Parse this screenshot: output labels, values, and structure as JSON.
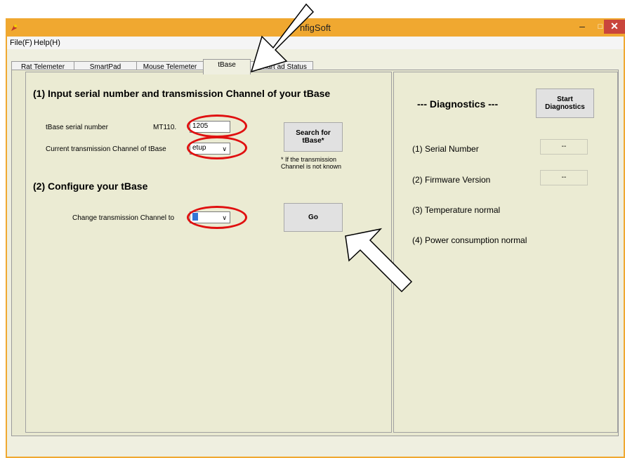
{
  "window": {
    "title": "ConfigSoft",
    "visible_title": "nfigSoft"
  },
  "menu": {
    "file": "File(F)",
    "help": "Help(H)"
  },
  "tabs": [
    {
      "label": "Rat Telemeter"
    },
    {
      "label": "SmartPad"
    },
    {
      "label": "Mouse Telemeter"
    },
    {
      "label": "tBase"
    },
    {
      "label": "SmartPad Status",
      "visible_label": "Smart    ad Status"
    }
  ],
  "active_tab": "tBase",
  "left": {
    "section1_title": "(1) Input serial number and transmission Channel of your tBase",
    "serial_label": "tBase serial number",
    "serial_prefix": "MT110.",
    "serial_value": "1205",
    "channel_label": "Current transmission Channel of tBase",
    "channel_value": "Setup",
    "channel_visible": "etup",
    "search_button": "Search for tBase*",
    "search_line1": "Search for",
    "search_line2": "tBase*",
    "note_line1": "* If the transmission",
    "note_line2": "Channel is not known",
    "section2_title": "(2) Configure your tBase",
    "change_label": "Change transmission Channel to",
    "change_value": "",
    "go_button": "Go"
  },
  "right": {
    "title": "--- Diagnostics ---",
    "start_line1": "Start",
    "start_line2": "Diagnostics",
    "serial_label": "(1) Serial Number",
    "serial_value": "--",
    "firmware_label": "(2) Firmware Version",
    "firmware_value": "--",
    "temp_label": "(3) Temperature normal",
    "power_label": "(4) Power consumption normal"
  },
  "colors": {
    "titlebar": "#f0a830",
    "annotation_red": "#e01010",
    "close_button": "#c9453c"
  }
}
